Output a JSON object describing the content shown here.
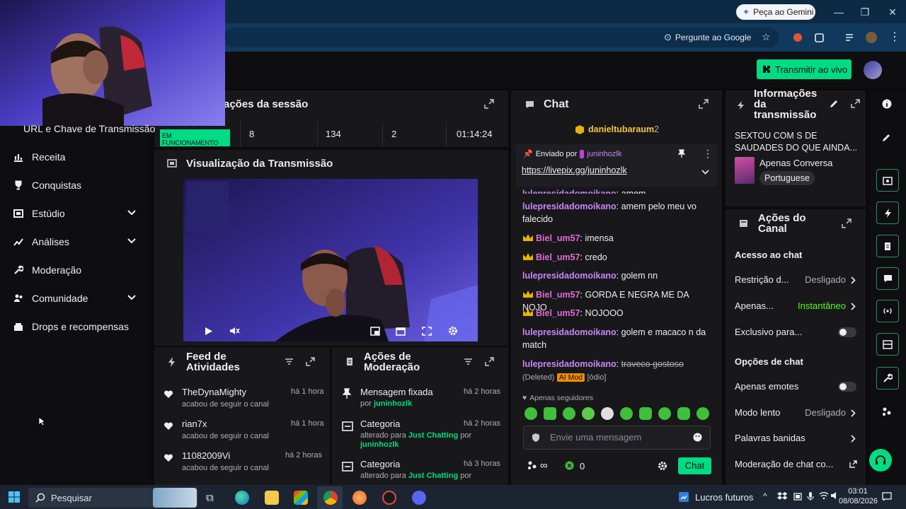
{
  "browser": {
    "gemini_button": "Peça ao Gemini",
    "ask_google": "Pergunte ao Google"
  },
  "appbar": {
    "go_live": "Transmitir ao vivo"
  },
  "sidebar": {
    "stream_key": "URL e Chave de Transmissão",
    "items": [
      {
        "label": "Receita",
        "icon": "revenue-icon",
        "expand": false
      },
      {
        "label": "Conquistas",
        "icon": "trophy-icon",
        "expand": false
      },
      {
        "label": "Estúdio",
        "icon": "studio-icon",
        "expand": true
      },
      {
        "label": "Análises",
        "icon": "analytics-icon",
        "expand": true
      },
      {
        "label": "Moderação",
        "icon": "wrench-icon",
        "expand": false
      },
      {
        "label": "Comunidade",
        "icon": "community-icon",
        "expand": true
      },
      {
        "label": "Drops e recompensas",
        "icon": "drops-icon",
        "expand": false
      }
    ]
  },
  "session": {
    "title": "ações da sessão",
    "status": "EM FUNCIONAMENTO",
    "stats": [
      "8",
      "134",
      "2",
      "01:14:24"
    ]
  },
  "preview": {
    "title": "Visualização da Transmissão"
  },
  "feed": {
    "title_line1": "Feed de",
    "title_line2": "Atividades",
    "items": [
      {
        "name": "TheDynaMighty",
        "action": "acabou de seguir o canal",
        "time": "há 1 hora"
      },
      {
        "name": "rian7x",
        "action": "acabou de seguir o canal",
        "time": "há 1 hora"
      },
      {
        "name": "11082009Vi",
        "action": "acabou de seguir o canal",
        "time": "há 2 horas"
      }
    ]
  },
  "moderation": {
    "title_line1": "Ações de",
    "title_line2": "Moderação",
    "items": [
      {
        "title": "Mensagem fixada",
        "pre": "por",
        "target": "juninhozlk",
        "post": "",
        "time": "há 2 horas"
      },
      {
        "title": "Categoria",
        "pre": "alterado para",
        "target": "Just Chatting",
        "post": "por",
        "extra": "juninhozlk",
        "time": "há 2 horas"
      },
      {
        "title": "Categoria",
        "pre": "alterado para",
        "target": "Just Chatting",
        "post": "por",
        "extra": "",
        "time": "há 3 horas"
      }
    ]
  },
  "chat": {
    "title": "Chat",
    "top_gifter": "danieltubaraum",
    "top_gifter_count": "2",
    "pinned_by_label": "Enviado por",
    "pinned_by_user": "juninhozlk",
    "pinned_link": "https://livepix.gg/juninhozlk",
    "messages": [
      {
        "user": "lulepresidadomoikano",
        "text": "amem",
        "crown": false
      },
      {
        "user": "lulepresidadomoikano",
        "text": "amem pelo meu vo falecido",
        "crown": false
      },
      {
        "user": "Biel_um57",
        "text": "imensa",
        "crown": true
      },
      {
        "user": "Biel_um57",
        "text": "credo",
        "crown": true
      },
      {
        "user": "lulepresidadomoikano",
        "text": "golem nn",
        "crown": false
      },
      {
        "user": "Biel_um57",
        "text": "GORDA E NEGRA ME DA NOJO",
        "crown": true
      },
      {
        "user": "Biel_um57",
        "text": "NOJOOO",
        "crown": true
      },
      {
        "user": "lulepresidadomoikano",
        "text": "golem e macaco n da match",
        "crown": false
      },
      {
        "user": "lulepresidadomoikano",
        "text": "traveco gostoso",
        "crown": false
      }
    ],
    "deleted_label": "(Deleted)",
    "ai_mod_label": "AI Mod",
    "hate_tag": "[ódio]",
    "followers_only": "Apenas seguidores",
    "input_placeholder": "Envie uma mensagem",
    "points": "0",
    "send": "Chat"
  },
  "stream_info": {
    "title_line1": "Informações",
    "title_line2": "da",
    "title_line3": "transmissão",
    "description": "SEXTOU COM S DE SAUDADES DO QUE AINDA...",
    "category": "Apenas Conversa",
    "language": "Portuguese"
  },
  "channel_actions": {
    "title_line1": "Ações do",
    "title_line2": "Canal",
    "chat_access": "Acesso ao chat",
    "restriction": "Restrição d...",
    "restriction_value": "Desligado",
    "only": "Apenas...",
    "only_value": "Instantâneo",
    "exclusive": "Exclusivo para...",
    "chat_options": "Opções de chat",
    "emotes_only": "Apenas emotes",
    "slow_mode": "Modo lento",
    "slow_value": "Desligado",
    "banned_words": "Palavras banidas",
    "chat_moderation": "Moderação de chat co..."
  },
  "taskbar": {
    "search": "Pesquisar",
    "stocks": "Lucros futuros",
    "time": "03:01",
    "date": "08/08/2026"
  },
  "colors": {
    "accent": "#00db84",
    "panel": "#18181b",
    "bg": "#0e0e10"
  }
}
